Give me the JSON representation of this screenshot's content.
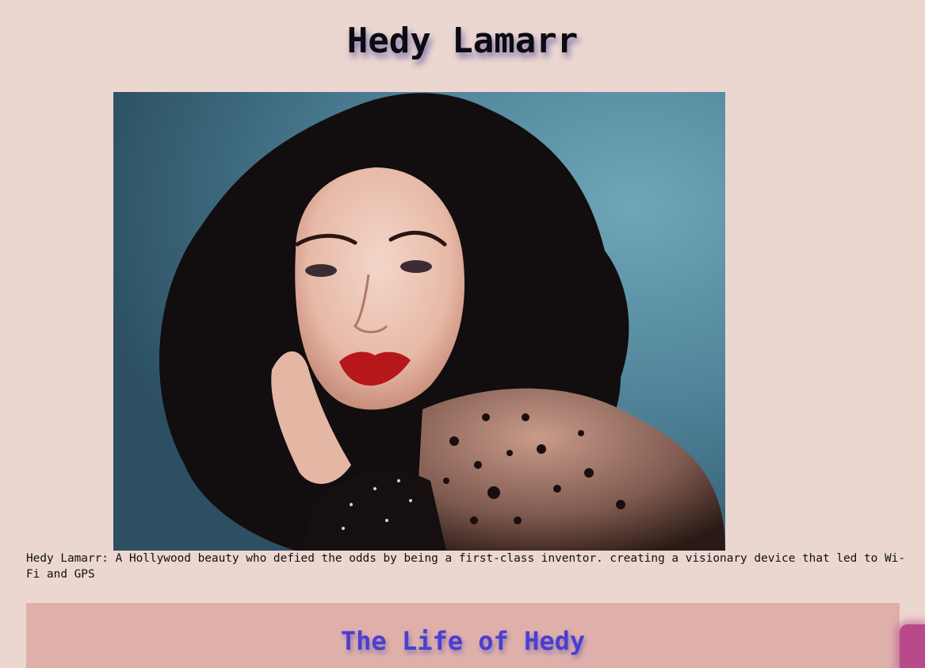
{
  "page": {
    "title": "Hedy Lamarr"
  },
  "figure": {
    "image_alt": "Portrait of Hedy Lamarr",
    "caption": "Hedy Lamarr: A Hollywood beauty who defied the odds by being a first-class inventor. creating a visionary device that led to Wi-Fi and GPS"
  },
  "section": {
    "heading": "The Life of Hedy"
  },
  "colors": {
    "background": "#ecd6d0",
    "section_background": "#dfb0aa",
    "heading_color": "#4b3fd1",
    "accent": "#b84a8c"
  }
}
